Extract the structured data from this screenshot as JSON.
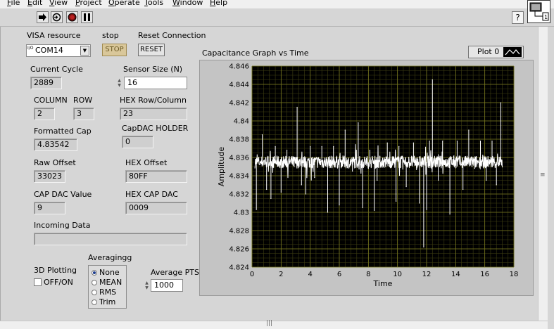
{
  "menu": [
    "File",
    "Edit",
    "View",
    "Project",
    "Operate",
    "Tools",
    "Window",
    "Help"
  ],
  "toolbar": {
    "run_icon": "run-arrow-icon",
    "run_continuous_icon": "run-continuously-icon",
    "abort_icon": "abort-execution-icon",
    "pause_icon": "pause-icon",
    "help_label": "?"
  },
  "vi_icon_label": "1",
  "visa": {
    "label": "VISA resource",
    "value": "COM14",
    "prefix": "I/O"
  },
  "stop": {
    "label": "stop",
    "button": "STOP"
  },
  "reset": {
    "label": "Reset Connection",
    "button": "RESET"
  },
  "current_cycle": {
    "label": "Current Cycle",
    "value": "2889"
  },
  "sensor_size": {
    "label": "Sensor Size (N)",
    "value": "16"
  },
  "column": {
    "label": "COLUMN",
    "value": "2"
  },
  "row": {
    "label": "ROW",
    "value": "3"
  },
  "hex_row_col": {
    "label": "HEX Row/Column",
    "value": "23"
  },
  "formatted_cap": {
    "label": "Formatted Cap",
    "value": "4.83542"
  },
  "capdac_holder": {
    "label": "CapDAC HOLDER",
    "value": "0"
  },
  "raw_offset": {
    "label": "Raw Offset",
    "value": "33023"
  },
  "hex_offset": {
    "label": "HEX Offset",
    "value": "80FF"
  },
  "cap_dac_value": {
    "label": "CAP DAC Value",
    "value": "9"
  },
  "hex_cap_dac": {
    "label": "HEX CAP DAC",
    "value": "0009"
  },
  "incoming_data": {
    "label": "Incoming Data",
    "value": ""
  },
  "plotting_3d": {
    "label": "3D Plotting",
    "toggle_label": "OFF/ON",
    "checked": false
  },
  "averaging": {
    "label": "Averagingg",
    "options": [
      "None",
      "MEAN",
      "RMS",
      "Trim"
    ],
    "selected": "None"
  },
  "average_pts": {
    "label": "Average PTS",
    "value": "1000"
  },
  "graph": {
    "legend_label": "Plot 0"
  },
  "colors": {
    "plot_bg": "#000000",
    "grid": "#7a7a20",
    "trace": "#ffffff",
    "panel": "#d6d6d6"
  },
  "chart_data": {
    "type": "line",
    "title": "Capacitance Graph vs Time",
    "xlabel": "Time",
    "ylabel": "Amplitude",
    "xlim": [
      0,
      18
    ],
    "ylim": [
      4.824,
      4.846
    ],
    "x_ticks": [
      "0",
      "2",
      "4",
      "6",
      "8",
      "10",
      "12",
      "14",
      "16",
      "18"
    ],
    "y_ticks": [
      "4.824",
      "4.826",
      "4.828",
      "4.83",
      "4.832",
      "4.834",
      "4.836",
      "4.838",
      "4.84",
      "4.842",
      "4.844",
      "4.846"
    ],
    "grid": true,
    "series": [
      {
        "name": "Plot 0",
        "baseline": 4.8355,
        "noise": 0.0007,
        "x_range": [
          0.2,
          17.2
        ],
        "spikes": [
          [
            0.3,
            4.8303
          ],
          [
            0.7,
            4.8385
          ],
          [
            1.0,
            4.8325
          ],
          [
            1.3,
            4.8315
          ],
          [
            1.6,
            4.8372
          ],
          [
            2.0,
            4.8322
          ],
          [
            2.4,
            4.8368
          ],
          [
            2.9,
            4.835
          ],
          [
            3.1,
            4.8415
          ],
          [
            3.4,
            4.833
          ],
          [
            3.7,
            4.832
          ],
          [
            4.0,
            4.8372
          ],
          [
            4.3,
            4.8338
          ],
          [
            4.8,
            4.8372
          ],
          [
            5.2,
            4.83
          ],
          [
            5.6,
            4.8372
          ],
          [
            6.0,
            4.8308
          ],
          [
            6.4,
            4.839
          ],
          [
            6.9,
            4.8345
          ],
          [
            7.3,
            4.8398
          ],
          [
            7.6,
            4.8305
          ],
          [
            8.1,
            4.8368
          ],
          [
            8.4,
            4.8302
          ],
          [
            8.6,
            4.8335
          ],
          [
            9.0,
            4.8352
          ],
          [
            9.3,
            4.8376
          ],
          [
            9.9,
            4.8312
          ],
          [
            10.1,
            4.8372
          ],
          [
            10.6,
            4.8328
          ],
          [
            11.1,
            4.8376
          ],
          [
            11.5,
            4.831
          ],
          [
            11.8,
            4.8262
          ],
          [
            12.0,
            4.8303
          ],
          [
            12.2,
            4.8378
          ],
          [
            12.4,
            4.8445
          ],
          [
            12.8,
            4.8335
          ],
          [
            13.1,
            4.8378
          ],
          [
            13.6,
            4.8298
          ],
          [
            14.1,
            4.8378
          ],
          [
            14.5,
            4.8325
          ],
          [
            14.9,
            4.839
          ],
          [
            15.3,
            4.8348
          ],
          [
            15.7,
            4.8378
          ],
          [
            16.1,
            4.8335
          ],
          [
            16.5,
            4.8378
          ],
          [
            16.8,
            4.833
          ],
          [
            17.1,
            4.842
          ]
        ]
      }
    ]
  }
}
